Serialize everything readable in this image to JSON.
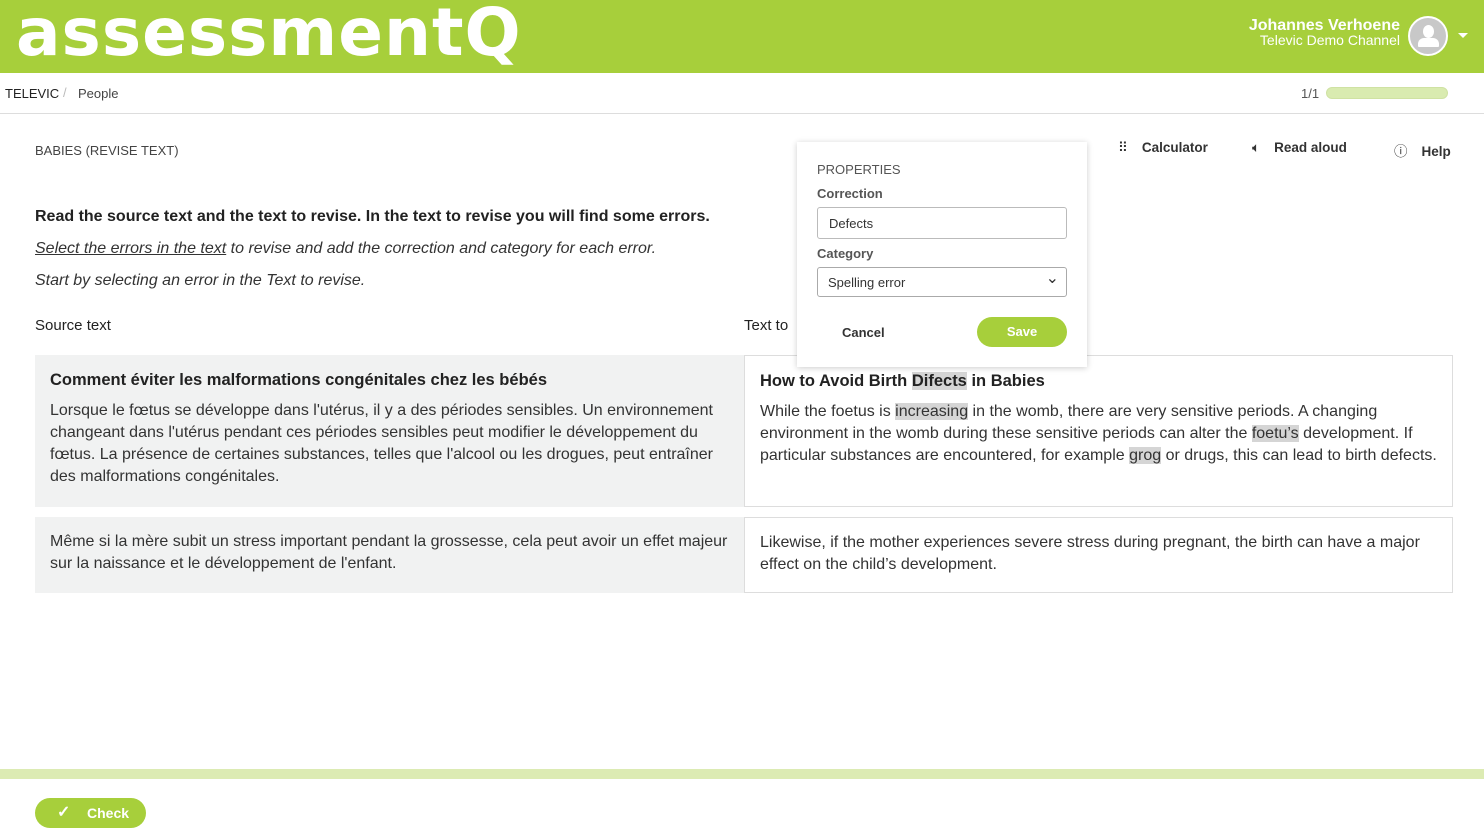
{
  "header": {
    "logo": "assessmentQ",
    "user_name": "Johannes Verhoene",
    "channel": "Televic Demo Channel"
  },
  "breadcrumb": {
    "items": [
      "TELEVIC",
      "People"
    ],
    "separator": "/"
  },
  "progress": {
    "label": "1/1",
    "percent": 100
  },
  "question": {
    "title": "BABIES (REVISE TEXT)",
    "instruction_bold": "Read the source text and the text to revise. In the text to revise you will find some errors.",
    "instruction_link": "Select the errors in the text",
    "instruction_rest": " to revise and add the correction and category for each error.",
    "instruction_start": "Start by selecting an error in the Text to revise."
  },
  "toolbar": {
    "calculator": "Calculator",
    "read_aloud": "Read aloud",
    "help": "Help"
  },
  "labels": {
    "source": "Source text",
    "target": "Text to"
  },
  "source": {
    "title": "Comment éviter les malformations congénitales chez les bébés",
    "p1": "Lorsque le fœtus se développe dans l'utérus, il y a des périodes sensibles. Un environnement changeant dans l'utérus pendant ces périodes sensibles peut modifier le développement du fœtus. La présence de certaines substances, telles que l'alcool ou les drogues, peut entraîner des malformations congénitales.",
    "p2": "Même si la mère subit un stress important pendant la grossesse, cela peut avoir un effet majeur sur la naissance et le développement de l'enfant."
  },
  "target": {
    "t1": "How to Avoid Birth ",
    "t_err": "Difects",
    "t2": " in Babies",
    "a1": "While the foetus is ",
    "e1": "increasing",
    "a2": " in the womb, there are very sensitive periods. A changing environment in the womb during these sensitive periods can alter the ",
    "e2": "foetu’s",
    "a3": " development. If particular substances are encountered, for example ",
    "e3": "grog",
    "a4": " or drugs, this can lead to birth defects.",
    "p2": "Likewise, if the mother experiences severe stress during pregnant, the birth can have a major effect on the child’s development."
  },
  "popup": {
    "heading": "PROPERTIES",
    "correction_label": "Correction",
    "correction_value": "Defects",
    "category_label": "Category",
    "category_value": "Spelling error",
    "cancel": "Cancel",
    "save": "Save"
  },
  "footer": {
    "check": "Check"
  },
  "colors": {
    "brand": "#a7cf3b",
    "highlight": "#d5d5d5"
  }
}
